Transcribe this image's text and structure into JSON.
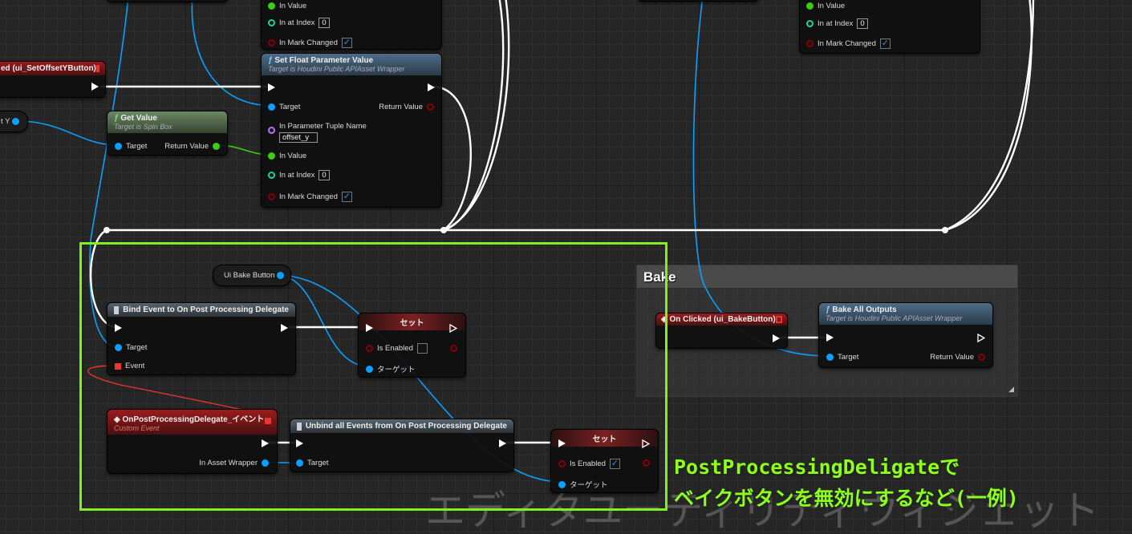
{
  "watermark": "エディタユーティリティウィジェット",
  "colors": {
    "object_pin": "#0aa0ff",
    "float_pin": "#3ccc14",
    "int_pin": "#1ad6a0",
    "bool_pin": "#8a0000",
    "string_pin": "#c070ff",
    "annotation": "#80f020",
    "exec_wire": "#ffffff"
  },
  "top_partial_center": {
    "pins": [
      "In Value",
      "In at Index",
      "In Mark Changed"
    ],
    "index_value": "0",
    "mark_changed": true
  },
  "top_partial_right": {
    "pins": [
      "In Value",
      "In at Index",
      "In Mark Changed"
    ],
    "index_value": "0",
    "mark_changed": true
  },
  "event_offset_y": {
    "title": "ed (ui_SetOffsetYButton)"
  },
  "var_offset_y": {
    "label": "t Y"
  },
  "get_value": {
    "title": "Get Value",
    "subtitle": "Target is Spin Box",
    "target": "Target",
    "return": "Return Value"
  },
  "set_float": {
    "title": "Set Float Parameter Value",
    "subtitle": "Target is Houdini Public APIAsset Wrapper",
    "target": "Target",
    "return": "Return Value",
    "tuple_label": "In Parameter Tuple Name",
    "tuple_value": "offset_y",
    "in_value": "In Value",
    "index_label": "In at Index",
    "index_value": "0",
    "mark_label": "In Mark Changed",
    "mark_changed": true
  },
  "ui_bake_button": {
    "label": "Ui Bake Button"
  },
  "bind_event": {
    "title": "Bind Event to On Post Processing Delegate",
    "target": "Target",
    "event": "Event"
  },
  "set1": {
    "title": "セット",
    "is_enabled": "Is Enabled",
    "enabled": false,
    "target": "ターゲット"
  },
  "custom_event": {
    "title": "OnPostProcessingDelegate_イベント",
    "subtitle": "Custom Event",
    "pin": "In Asset Wrapper"
  },
  "unbind": {
    "title": "Unbind all Events from On Post Processing Delegate",
    "target": "Target"
  },
  "set2": {
    "title": "セット",
    "is_enabled": "Is Enabled",
    "enabled": true,
    "target": "ターゲット"
  },
  "bake_comment": {
    "title": "Bake"
  },
  "on_clicked": {
    "title": "On Clicked (ui_BakeButton)"
  },
  "bake_all": {
    "title": "Bake All Outputs",
    "subtitle": "Target is Houdini Public APIAsset Wrapper",
    "target": "Target",
    "return": "Return Value"
  },
  "annotation": {
    "line1": "PostProcessingDeligateで",
    "line2": "ベイクボタンを無効にするなど(一例)"
  },
  "check_mark": "✓",
  "func_icon": "ƒ"
}
